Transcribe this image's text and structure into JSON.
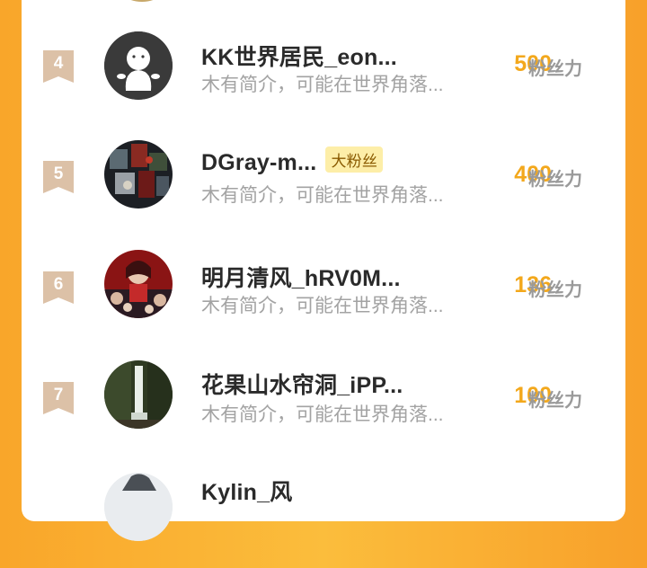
{
  "unit_label": "粉丝力",
  "rows": [
    {
      "rank": "4",
      "name": "KK世界居民_eon...",
      "bio": "木有简介，可能在世界角落...",
      "count": "500",
      "tag": ""
    },
    {
      "rank": "5",
      "name": "DGray-m...",
      "bio": "木有简介，可能在世界角落...",
      "count": "400",
      "tag": "大粉丝"
    },
    {
      "rank": "6",
      "name": "明月清风_hRV0M...",
      "bio": "木有简介，可能在世界角落...",
      "count": "136",
      "tag": ""
    },
    {
      "rank": "7",
      "name": "花果山水帘洞_iPP...",
      "bio": "木有简介，可能在世界角落...",
      "count": "100",
      "tag": ""
    },
    {
      "rank": "",
      "name": "Kylin_风",
      "bio": "",
      "count": "",
      "tag": ""
    }
  ],
  "colors": {
    "background": "#f9a62a",
    "count": "#f3a81c",
    "badge": "#dcc1a7",
    "tag_bg": "#fdeea8"
  }
}
